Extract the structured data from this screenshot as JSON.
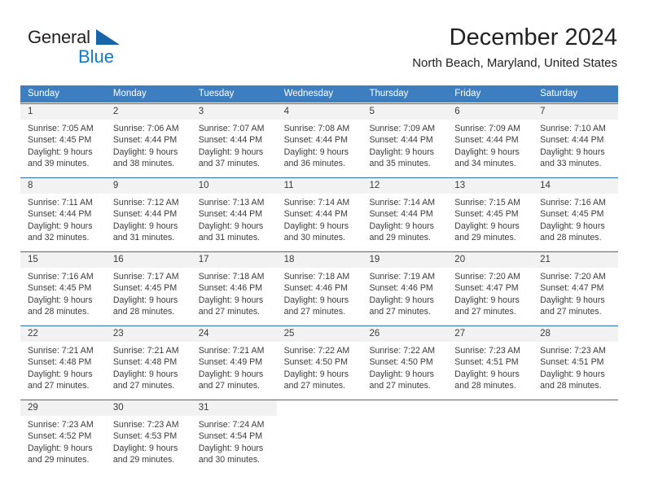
{
  "brand": {
    "name_top": "General",
    "name_bottom": "Blue",
    "accent_color": "#1579c1",
    "triangle_color": "#1565a8"
  },
  "header": {
    "title": "December 2024",
    "subtitle": "North Beach, Maryland, United States"
  },
  "calendar": {
    "header_bg": "#3c7ebf",
    "header_text_color": "#ffffff",
    "row_border_color": "#2f6ca8",
    "daynum_bg": "#f2f2f2",
    "weekdays": [
      "Sunday",
      "Monday",
      "Tuesday",
      "Wednesday",
      "Thursday",
      "Friday",
      "Saturday"
    ],
    "weeks": [
      [
        {
          "day": "1",
          "sunrise": "Sunrise: 7:05 AM",
          "sunset": "Sunset: 4:45 PM",
          "daylight1": "Daylight: 9 hours",
          "daylight2": "and 39 minutes."
        },
        {
          "day": "2",
          "sunrise": "Sunrise: 7:06 AM",
          "sunset": "Sunset: 4:44 PM",
          "daylight1": "Daylight: 9 hours",
          "daylight2": "and 38 minutes."
        },
        {
          "day": "3",
          "sunrise": "Sunrise: 7:07 AM",
          "sunset": "Sunset: 4:44 PM",
          "daylight1": "Daylight: 9 hours",
          "daylight2": "and 37 minutes."
        },
        {
          "day": "4",
          "sunrise": "Sunrise: 7:08 AM",
          "sunset": "Sunset: 4:44 PM",
          "daylight1": "Daylight: 9 hours",
          "daylight2": "and 36 minutes."
        },
        {
          "day": "5",
          "sunrise": "Sunrise: 7:09 AM",
          "sunset": "Sunset: 4:44 PM",
          "daylight1": "Daylight: 9 hours",
          "daylight2": "and 35 minutes."
        },
        {
          "day": "6",
          "sunrise": "Sunrise: 7:09 AM",
          "sunset": "Sunset: 4:44 PM",
          "daylight1": "Daylight: 9 hours",
          "daylight2": "and 34 minutes."
        },
        {
          "day": "7",
          "sunrise": "Sunrise: 7:10 AM",
          "sunset": "Sunset: 4:44 PM",
          "daylight1": "Daylight: 9 hours",
          "daylight2": "and 33 minutes."
        }
      ],
      [
        {
          "day": "8",
          "sunrise": "Sunrise: 7:11 AM",
          "sunset": "Sunset: 4:44 PM",
          "daylight1": "Daylight: 9 hours",
          "daylight2": "and 32 minutes."
        },
        {
          "day": "9",
          "sunrise": "Sunrise: 7:12 AM",
          "sunset": "Sunset: 4:44 PM",
          "daylight1": "Daylight: 9 hours",
          "daylight2": "and 31 minutes."
        },
        {
          "day": "10",
          "sunrise": "Sunrise: 7:13 AM",
          "sunset": "Sunset: 4:44 PM",
          "daylight1": "Daylight: 9 hours",
          "daylight2": "and 31 minutes."
        },
        {
          "day": "11",
          "sunrise": "Sunrise: 7:14 AM",
          "sunset": "Sunset: 4:44 PM",
          "daylight1": "Daylight: 9 hours",
          "daylight2": "and 30 minutes."
        },
        {
          "day": "12",
          "sunrise": "Sunrise: 7:14 AM",
          "sunset": "Sunset: 4:44 PM",
          "daylight1": "Daylight: 9 hours",
          "daylight2": "and 29 minutes."
        },
        {
          "day": "13",
          "sunrise": "Sunrise: 7:15 AM",
          "sunset": "Sunset: 4:45 PM",
          "daylight1": "Daylight: 9 hours",
          "daylight2": "and 29 minutes."
        },
        {
          "day": "14",
          "sunrise": "Sunrise: 7:16 AM",
          "sunset": "Sunset: 4:45 PM",
          "daylight1": "Daylight: 9 hours",
          "daylight2": "and 28 minutes."
        }
      ],
      [
        {
          "day": "15",
          "sunrise": "Sunrise: 7:16 AM",
          "sunset": "Sunset: 4:45 PM",
          "daylight1": "Daylight: 9 hours",
          "daylight2": "and 28 minutes."
        },
        {
          "day": "16",
          "sunrise": "Sunrise: 7:17 AM",
          "sunset": "Sunset: 4:45 PM",
          "daylight1": "Daylight: 9 hours",
          "daylight2": "and 28 minutes."
        },
        {
          "day": "17",
          "sunrise": "Sunrise: 7:18 AM",
          "sunset": "Sunset: 4:46 PM",
          "daylight1": "Daylight: 9 hours",
          "daylight2": "and 27 minutes."
        },
        {
          "day": "18",
          "sunrise": "Sunrise: 7:18 AM",
          "sunset": "Sunset: 4:46 PM",
          "daylight1": "Daylight: 9 hours",
          "daylight2": "and 27 minutes."
        },
        {
          "day": "19",
          "sunrise": "Sunrise: 7:19 AM",
          "sunset": "Sunset: 4:46 PM",
          "daylight1": "Daylight: 9 hours",
          "daylight2": "and 27 minutes."
        },
        {
          "day": "20",
          "sunrise": "Sunrise: 7:20 AM",
          "sunset": "Sunset: 4:47 PM",
          "daylight1": "Daylight: 9 hours",
          "daylight2": "and 27 minutes."
        },
        {
          "day": "21",
          "sunrise": "Sunrise: 7:20 AM",
          "sunset": "Sunset: 4:47 PM",
          "daylight1": "Daylight: 9 hours",
          "daylight2": "and 27 minutes."
        }
      ],
      [
        {
          "day": "22",
          "sunrise": "Sunrise: 7:21 AM",
          "sunset": "Sunset: 4:48 PM",
          "daylight1": "Daylight: 9 hours",
          "daylight2": "and 27 minutes."
        },
        {
          "day": "23",
          "sunrise": "Sunrise: 7:21 AM",
          "sunset": "Sunset: 4:48 PM",
          "daylight1": "Daylight: 9 hours",
          "daylight2": "and 27 minutes."
        },
        {
          "day": "24",
          "sunrise": "Sunrise: 7:21 AM",
          "sunset": "Sunset: 4:49 PM",
          "daylight1": "Daylight: 9 hours",
          "daylight2": "and 27 minutes."
        },
        {
          "day": "25",
          "sunrise": "Sunrise: 7:22 AM",
          "sunset": "Sunset: 4:50 PM",
          "daylight1": "Daylight: 9 hours",
          "daylight2": "and 27 minutes."
        },
        {
          "day": "26",
          "sunrise": "Sunrise: 7:22 AM",
          "sunset": "Sunset: 4:50 PM",
          "daylight1": "Daylight: 9 hours",
          "daylight2": "and 27 minutes."
        },
        {
          "day": "27",
          "sunrise": "Sunrise: 7:23 AM",
          "sunset": "Sunset: 4:51 PM",
          "daylight1": "Daylight: 9 hours",
          "daylight2": "and 28 minutes."
        },
        {
          "day": "28",
          "sunrise": "Sunrise: 7:23 AM",
          "sunset": "Sunset: 4:51 PM",
          "daylight1": "Daylight: 9 hours",
          "daylight2": "and 28 minutes."
        }
      ],
      [
        {
          "day": "29",
          "sunrise": "Sunrise: 7:23 AM",
          "sunset": "Sunset: 4:52 PM",
          "daylight1": "Daylight: 9 hours",
          "daylight2": "and 29 minutes."
        },
        {
          "day": "30",
          "sunrise": "Sunrise: 7:23 AM",
          "sunset": "Sunset: 4:53 PM",
          "daylight1": "Daylight: 9 hours",
          "daylight2": "and 29 minutes."
        },
        {
          "day": "31",
          "sunrise": "Sunrise: 7:24 AM",
          "sunset": "Sunset: 4:54 PM",
          "daylight1": "Daylight: 9 hours",
          "daylight2": "and 30 minutes."
        },
        {
          "day": "",
          "sunrise": "",
          "sunset": "",
          "daylight1": "",
          "daylight2": ""
        },
        {
          "day": "",
          "sunrise": "",
          "sunset": "",
          "daylight1": "",
          "daylight2": ""
        },
        {
          "day": "",
          "sunrise": "",
          "sunset": "",
          "daylight1": "",
          "daylight2": ""
        },
        {
          "day": "",
          "sunrise": "",
          "sunset": "",
          "daylight1": "",
          "daylight2": ""
        }
      ]
    ]
  }
}
